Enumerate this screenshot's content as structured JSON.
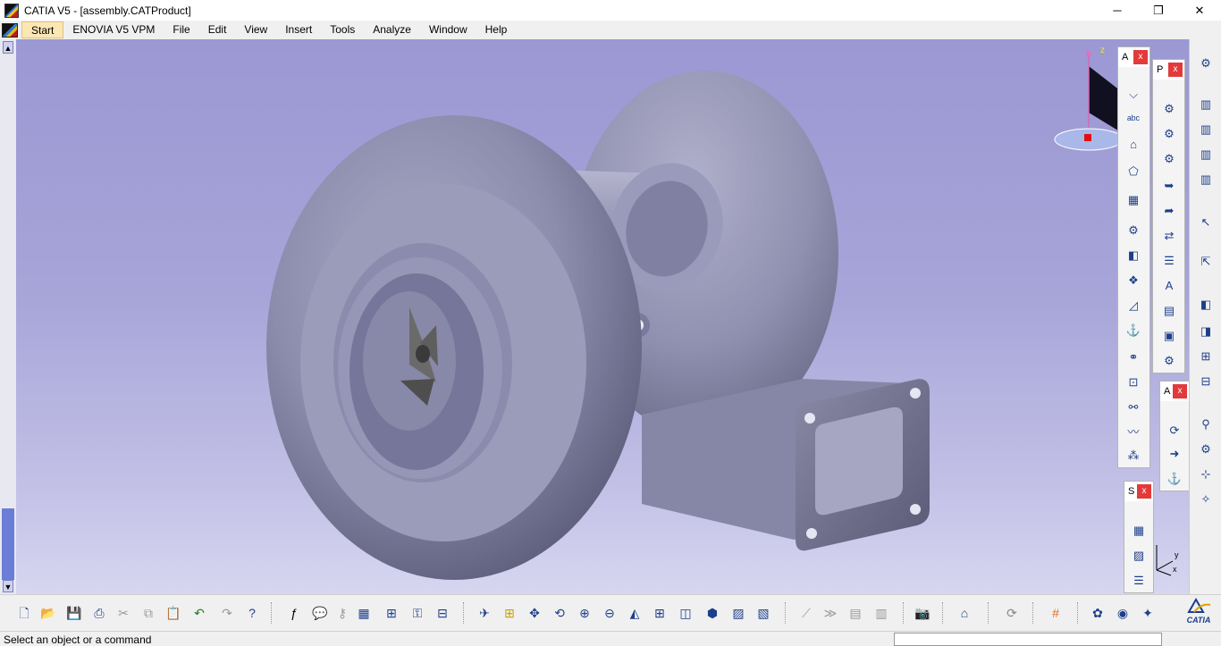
{
  "window": {
    "title": "CATIA V5 - [assembly.CATProduct]",
    "minimize_glyph": "─",
    "restore_glyph": "❐",
    "close_glyph": "✕"
  },
  "menu": {
    "items": [
      "Start",
      "ENOVIA V5 VPM",
      "File",
      "Edit",
      "View",
      "Insert",
      "Tools",
      "Analyze",
      "Window",
      "Help"
    ],
    "mdi_minimize": "_",
    "mdi_restore": "❐",
    "mdi_close": "✕"
  },
  "viewport": {
    "background_top": "#9b98d3",
    "background_bottom": "#d7d6f0",
    "part_color": "#8a8aa8",
    "compass_axis_label": "z",
    "triad_labels": {
      "y": "y",
      "x": "x"
    }
  },
  "toolbars": {
    "annotations": {
      "label": "A",
      "close": "x"
    },
    "product_structure": {
      "label": "P",
      "close": "x"
    },
    "assembly_constraints": {
      "label": "A",
      "close": "x"
    },
    "space_analysis": {
      "label": "S",
      "close": "x"
    }
  },
  "status": {
    "text": "Select an object or a command",
    "command_placeholder": ""
  },
  "brand": {
    "logo_text": "CATIA"
  }
}
